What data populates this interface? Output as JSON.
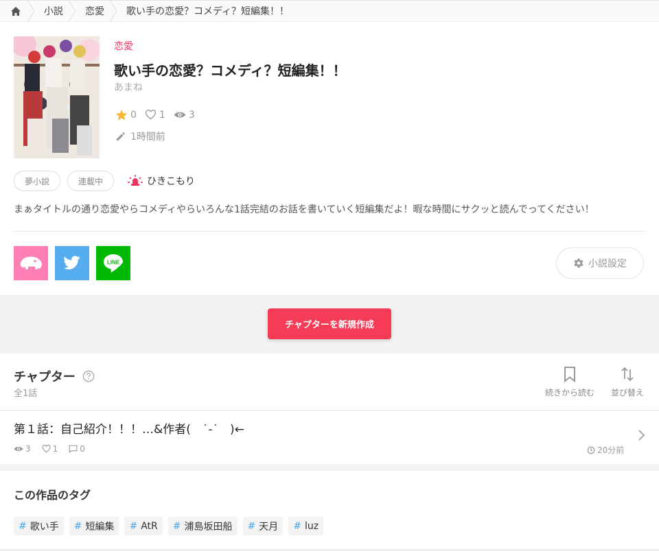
{
  "breadcrumb": {
    "home_icon": "home-icon",
    "items": [
      "小説",
      "恋愛"
    ],
    "current": "歌い手の恋愛？コメディ？短編集！！"
  },
  "novel": {
    "genre": "恋愛",
    "title": "歌い手の恋愛？コメディ？短編集！！",
    "author": "あまね",
    "stars": "0",
    "likes": "1",
    "views": "3",
    "updated": "1時間前",
    "badges": [
      "夢小説",
      "連載中"
    ],
    "status_label": "ひきこもり",
    "description": "まぁタイトルの通り恋愛やらコメディやらいろんな1話完結のお話を書いていく短編集だよ！暇な時間にサクッと読んでってください！"
  },
  "share": {
    "line_label": "LINE",
    "colors": {
      "uranai": "#ff7eb3",
      "twitter": "#55acee",
      "line": "#00b900"
    }
  },
  "settings_label": "小説設定",
  "new_chapter_label": "チャプターを新規作成",
  "chapters": {
    "title": "チャプター",
    "count": "全1話",
    "continue_label": "続きから読む",
    "sort_label": "並び替え",
    "items": [
      {
        "title": "第１話：自己紹介！！！…&作者(　˙-˙　)←",
        "views": "3",
        "likes": "1",
        "comments": "0",
        "time": "20分前"
      }
    ]
  },
  "tags": {
    "title": "この作品のタグ",
    "items": [
      "歌い手",
      "短編集",
      "AtR",
      "浦島坂田船",
      "天月",
      "luz"
    ]
  },
  "colors": {
    "accent": "#f63b56",
    "genre": "#f0365f",
    "tag_hash": "#4aa8e8",
    "star": "#f7b733"
  }
}
